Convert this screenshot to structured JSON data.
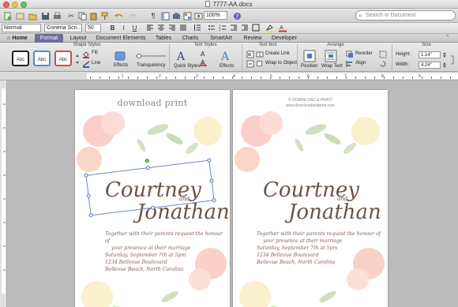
{
  "window": {
    "title": "7777-AA.docx"
  },
  "toolbar": {
    "zoom": "100%",
    "search_placeholder": "Search in Document"
  },
  "formatting": {
    "style": "Normal",
    "font": "Coneria Scri...",
    "size": "50",
    "bold": "B",
    "italic": "I",
    "underline": "U"
  },
  "ribbon_tabs": [
    {
      "label": "Home"
    },
    {
      "label": "Format"
    },
    {
      "label": "Layout"
    },
    {
      "label": "Document Elements"
    },
    {
      "label": "Tables"
    },
    {
      "label": "Charts"
    },
    {
      "label": "SmartArt"
    },
    {
      "label": "Review"
    },
    {
      "label": "Developer"
    }
  ],
  "ribbon": {
    "groups": {
      "shape_styles": "Shape Styles",
      "text_styles": "Text Styles",
      "text_box": "Text Box",
      "arrange": "Arrange",
      "size": "Size"
    },
    "shape_style_samples": [
      "Abc",
      "Abc",
      "Abc"
    ],
    "fill_label": "Fill",
    "line_label": "Line",
    "effects_label": "Effects",
    "transparency_label": "Transparency",
    "quick_styles_label": "Quick Styles",
    "text_effects_label": "Effects",
    "create_link_label": "Create Link",
    "wrap_to_object_label": "Wrap to Object",
    "position_label": "Position",
    "wrap_text_label": "Wrap Text",
    "reorder_label": "Reorder",
    "align_label": "Align",
    "height_label": "Height:",
    "height_value": "1.14\"",
    "width_label": "Width:",
    "width_value": "4.24\""
  },
  "ruler": {
    "numbers": [
      "1",
      "2",
      "3",
      "4",
      "5",
      "6",
      "7",
      "8",
      "9"
    ]
  },
  "cards": [
    {
      "brand": "download print",
      "copyright": "",
      "url": "",
      "name1": "Courtney",
      "and": "and",
      "name2": "Jonathan",
      "verse": [
        "Together with their parents request the honour of",
        "your presence at their marriage",
        "Saturday, September 7th at 5pm",
        "1234 Bellevue Boulevard",
        "Bellevue Beach, North Carolina"
      ]
    },
    {
      "brand": "",
      "copyright": "© DOWNLOAD & PRINT",
      "url": "www.downloadandprint.com",
      "name1": "Courtney",
      "and": "and",
      "name2": "Jonathan",
      "verse": [
        "Together with their parents request the honour of",
        "your presence at their marriage",
        "Saturday, September 7th at 5pm",
        "1234 Bellevue Boulevard",
        "Bellevue Beach, North Carolina"
      ]
    }
  ],
  "colors": {
    "active_tab": "#6d6d9f",
    "name_text": "#6b5447",
    "verse_text": "#8a5a4f"
  }
}
